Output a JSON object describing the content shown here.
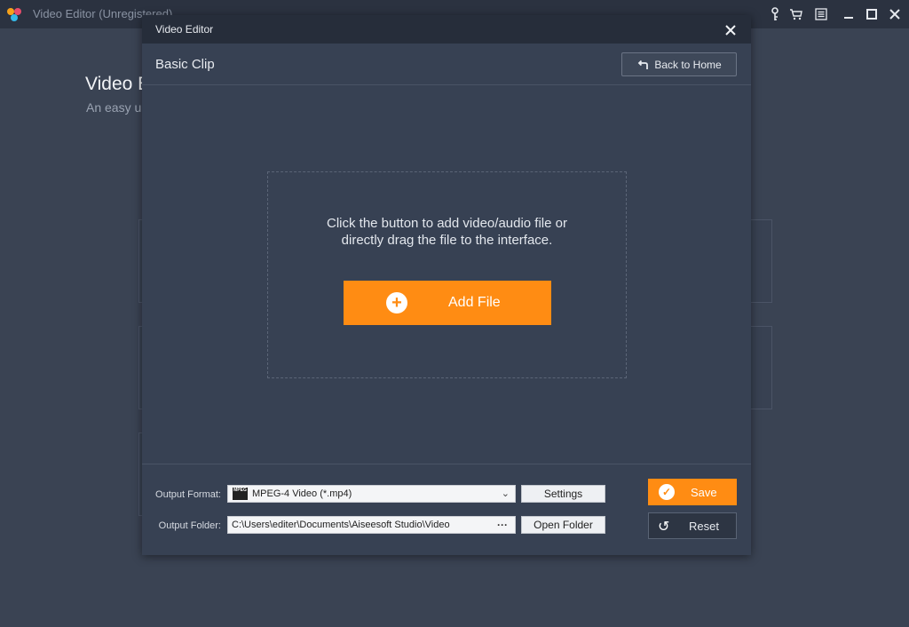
{
  "app": {
    "title": "Video Editor (Unregistered)",
    "icons": [
      "key-icon",
      "cart-icon",
      "register-icon",
      "minimize-icon",
      "maximize-icon",
      "close-icon"
    ]
  },
  "home": {
    "title": "Video E",
    "subtitle": "An easy u"
  },
  "dialog": {
    "title": "Video Editor",
    "section_title": "Basic Clip",
    "back_label": "Back to Home",
    "drop_line1": "Click the button to add video/audio file or",
    "drop_line2": "directly drag the file to the interface.",
    "add_file_label": "Add File",
    "output_format_label": "Output Format:",
    "output_format_value": "MPEG-4 Video (*.mp4)",
    "format_icon_text": "MPEG",
    "settings_label": "Settings",
    "output_folder_label": "Output Folder:",
    "output_folder_value": "C:\\Users\\editer\\Documents\\Aiseesoft Studio\\Video",
    "open_folder_label": "Open Folder",
    "save_label": "Save",
    "reset_label": "Reset"
  },
  "colors": {
    "accent": "#ff8c13",
    "background": "#3a4353",
    "titlebar": "#2b3240"
  }
}
